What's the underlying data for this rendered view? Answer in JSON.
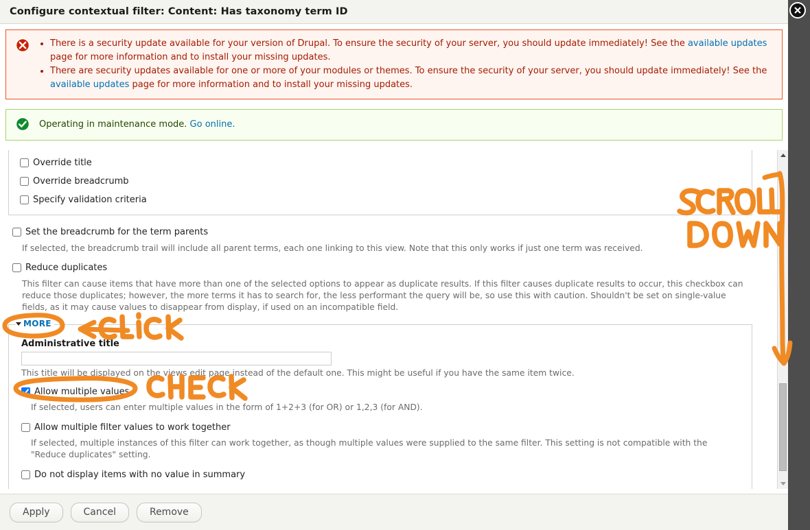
{
  "window": {
    "title": "Configure contextual filter: Content: Has taxonomy term ID",
    "close_icon": "close-circle-icon"
  },
  "messages": {
    "error": {
      "icon": "error-icon",
      "items": [
        {
          "before": "There is a security update available for your version of Drupal. To ensure the security of your server, you should update immediately! See the ",
          "link": "available updates",
          "after": " page for more information and to install your missing updates."
        },
        {
          "before": "There are security updates available for one or more of your modules or themes. To ensure the security of your server, you should update immediately! See the ",
          "link": "available updates",
          "after": " page for more information and to install your missing updates."
        }
      ]
    },
    "status": {
      "icon": "success-icon",
      "text": "Operating in maintenance mode. ",
      "link": "Go online.",
      "after": ""
    }
  },
  "form": {
    "top_options": [
      {
        "label": "Override title",
        "checked": false
      },
      {
        "label": "Override breadcrumb",
        "checked": false
      },
      {
        "label": "Specify validation criteria",
        "checked": false
      }
    ],
    "breadcrumb_parents": {
      "label": "Set the breadcrumb for the term parents",
      "checked": false,
      "description": "If selected, the breadcrumb trail will include all parent terms, each one linking to this view. Note that this only works if just one term was received."
    },
    "reduce_duplicates": {
      "label": "Reduce duplicates",
      "checked": false,
      "description": "This filter can cause items that have more than one of the selected options to appear as duplicate results. If this filter causes duplicate results to occur, this checkbox can reduce those duplicates; however, the more terms it has to search for, the less performant the query will be, so use this with caution. Shouldn't be set on single-value fields, as it may cause values to disappear from display, if used on an incompatible field."
    },
    "more": {
      "legend": "MORE",
      "expanded": true,
      "admin_title_label": "Administrative title",
      "admin_title_value": "",
      "admin_title_placeholder": "",
      "admin_title_description": "This title will be displayed on the views edit page instead of the default one. This might be useful if you have the same item twice.",
      "allow_multiple": {
        "label": "Allow multiple values",
        "checked": true,
        "description": "If selected, users can enter multiple values in the form of 1+2+3 (for OR) or 1,2,3 (for AND)."
      },
      "allow_multiple_together": {
        "label": "Allow multiple filter values to work together",
        "checked": false,
        "description": "If selected, multiple instances of this filter can work together, as though multiple values were supplied to the same filter. This setting is not compatible with the \"Reduce duplicates\" setting."
      },
      "no_value_summary": {
        "label": "Do not display items with no value in summary",
        "checked": false
      }
    }
  },
  "footer": {
    "apply_label": "Apply",
    "cancel_label": "Cancel",
    "remove_label": "Remove"
  },
  "scrollbar": {
    "up_icon": "triangle-up-icon",
    "down_icon": "triangle-down-icon"
  },
  "annotations": {
    "color": "#f08a24",
    "scroll_down": "SCROLL\nDOWN",
    "scroll_line1": "SCROLL",
    "scroll_line2": "DOWN",
    "click": "CLICK",
    "check": "CHECK"
  }
}
